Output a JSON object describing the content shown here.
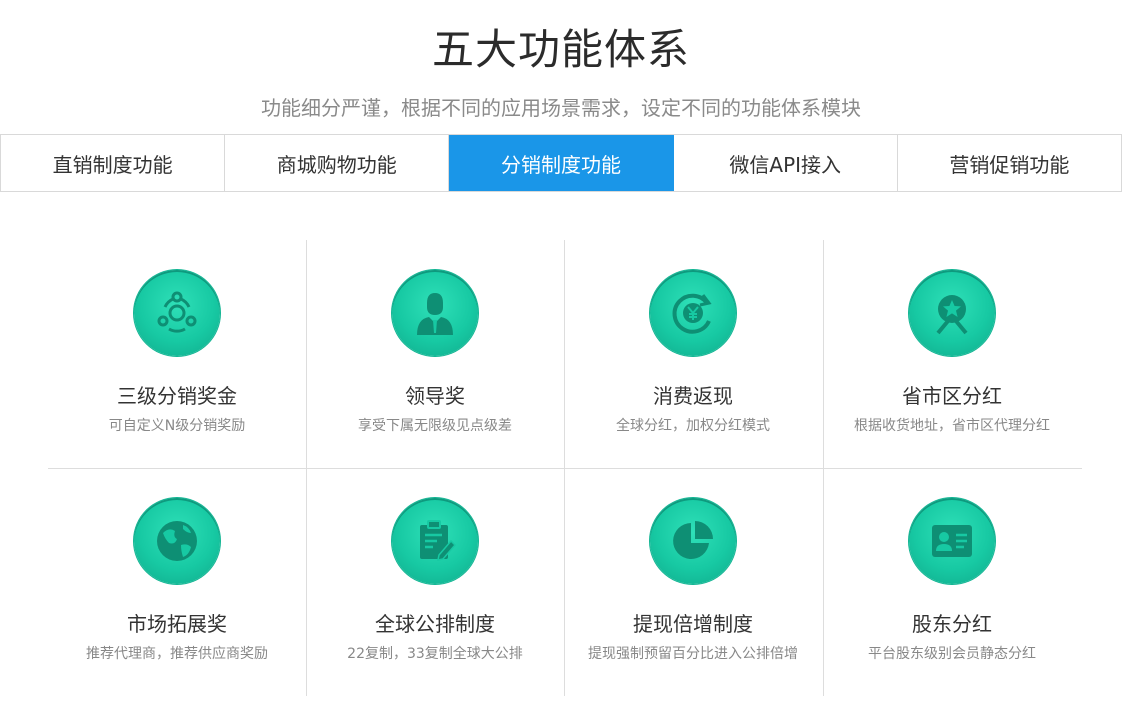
{
  "header": {
    "title": "五大功能体系",
    "subtitle": "功能细分严谨，根据不同的应用场景需求，设定不同的功能体系模块"
  },
  "tabs": [
    {
      "label": "直销制度功能",
      "active": false
    },
    {
      "label": "商城购物功能",
      "active": false
    },
    {
      "label": "分销制度功能",
      "active": true
    },
    {
      "label": "微信API接入",
      "active": false
    },
    {
      "label": "营销促销功能",
      "active": false
    }
  ],
  "colors": {
    "accent": "#1a96e8",
    "icon_green": "#17c9a3",
    "text_dark": "#333333",
    "text_muted": "#888888"
  },
  "features": [
    {
      "icon": "network-circles-icon",
      "title": "三级分销奖金",
      "desc": "可自定义N级分销奖励"
    },
    {
      "icon": "leader-person-icon",
      "title": "领导奖",
      "desc": "享受下属无限级见点级差"
    },
    {
      "icon": "yen-cycle-icon",
      "title": "消费返现",
      "desc": "全球分红，加权分红模式"
    },
    {
      "icon": "star-badge-icon",
      "title": "省市区分红",
      "desc": "根据收货地址，省市区代理分红"
    },
    {
      "icon": "globe-icon",
      "title": "市场拓展奖",
      "desc": "推荐代理商，推荐供应商奖励"
    },
    {
      "icon": "clipboard-pen-icon",
      "title": "全球公排制度",
      "desc": "22复制，33复制全球大公排"
    },
    {
      "icon": "pie-chart-icon",
      "title": "提现倍增制度",
      "desc": "提现强制预留百分比进入公排倍增"
    },
    {
      "icon": "id-card-icon",
      "title": "股东分红",
      "desc": "平台股东级别会员静态分红"
    }
  ]
}
